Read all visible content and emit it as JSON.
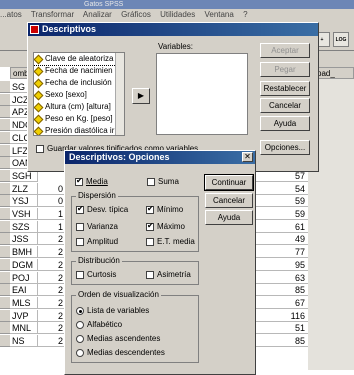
{
  "background": {
    "title": "Gatos SPSS",
    "menu": [
      "...atos",
      "Transformar",
      "Analizar",
      "Gráficos",
      "Utilidades",
      "Ventana",
      "?"
    ],
    "toolbar_right": [
      "+",
      "LOG"
    ],
    "column_headers": [
      "omb",
      "pad_"
    ],
    "left_ids": [
      "SG",
      "JCZ",
      "APZ",
      "NDC",
      "CLC",
      "LFZ",
      "OAN",
      "SGH",
      "ZLZ",
      "YSJ",
      "VSH",
      "SZS",
      "JSS",
      "BMH",
      "DGM",
      "POJ",
      "EAI",
      "MLS",
      "JVP",
      "MNL",
      "NS"
    ],
    "left_nums": [
      "0",
      "0",
      "1",
      "1",
      "2",
      "2",
      "2",
      "2",
      "2",
      "2",
      "2",
      "2",
      "2"
    ],
    "values": [
      "57",
      "54",
      "59",
      "59",
      "61",
      "49",
      "77",
      "95",
      "63",
      "85",
      "67",
      "116",
      "51",
      "85"
    ]
  },
  "descriptivos": {
    "title": "Descriptivos",
    "variables": [
      "Clave de aleatoriza",
      "Fecha de nacimien",
      "Fecha de inclusión",
      "Sexo [sexo]",
      "Altura (cm) [altura]",
      "Peso en Kg. [peso]",
      "Presión diastólica ir"
    ],
    "variables_label": "Variables:",
    "arrow": "▶",
    "buttons": [
      "Aceptar",
      "Pegar",
      "Restablecer",
      "Cancelar",
      "Ayuda",
      "Opciones..."
    ],
    "save_label": "Guardar valores tipificados como variables"
  },
  "opciones": {
    "title": "Descriptivos: Opciones",
    "close": "✕",
    "media": "Media",
    "suma": "Suma",
    "dispersion": {
      "title": "Dispersión",
      "items": [
        "Desv. típica",
        "Mínimo",
        "Varianza",
        "Máximo",
        "Amplitud",
        "E.T. media"
      ]
    },
    "distribucion": {
      "title": "Distribución",
      "items": [
        "Curtosis",
        "Asimetría"
      ]
    },
    "orden": {
      "title": "Orden de visualización",
      "items": [
        "Lista de variables",
        "Alfabético",
        "Medias ascendentes",
        "Medias descendentes"
      ]
    },
    "buttons": [
      "Continuar",
      "Cancelar",
      "Ayuda"
    ]
  }
}
